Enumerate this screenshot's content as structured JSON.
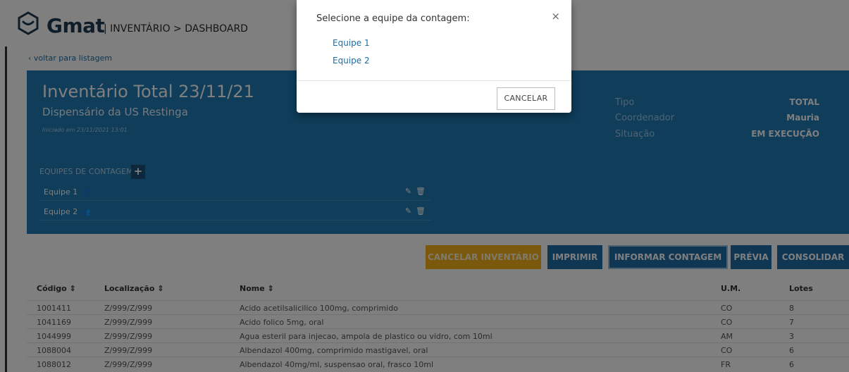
{
  "header": {
    "brand": "Gmat",
    "breadcrumb": "| INVENTÁRIO > DASHBOARD"
  },
  "back_link": "‹ voltar para listagem",
  "inventory": {
    "title": "Inventário Total 23/11/21",
    "subtitle": "Dispensário da US Restinga",
    "started": "Iniciado em 23/11/2021 13:01",
    "info": [
      {
        "label": "Tipo",
        "value": "TOTAL"
      },
      {
        "label": "Coordenador",
        "value": "Mauria"
      },
      {
        "label": "Situação",
        "value": "EM EXECUÇÃO"
      }
    ],
    "teams_header": "EQUIPES DE CONTAGEM",
    "add_icon": "+",
    "teams": [
      {
        "name": "Equipe 1",
        "icon": "👤",
        "edit": "✎",
        "delete": "🗑"
      },
      {
        "name": "Equipe 2",
        "icon": "👥",
        "edit": "✎",
        "delete": "🗑"
      }
    ]
  },
  "actions": {
    "cancel": "CANCELAR INVENTÁRIO",
    "print": "IMPRIMIR",
    "report": "INFORMAR CONTAGEM",
    "preview": "PRÉVIA",
    "consolidate": "CONSOLIDAR"
  },
  "table": {
    "columns": [
      "Código ⇕",
      "Localização ⇕",
      "Nome ⇕",
      "U.M.",
      "Lotes"
    ],
    "rows": [
      [
        "1001411",
        "Z/999/Z/999",
        "Acido acetilsalicilico 100mg, comprimido",
        "CO",
        "8"
      ],
      [
        "1041169",
        "Z/999/Z/999",
        "Acido folico 5mg, oral",
        "CO",
        "7"
      ],
      [
        "1044999",
        "Z/999/Z/999",
        "Agua esteril para injecao, ampola de plastico ou vidro, com 10ml",
        "AM",
        "3"
      ],
      [
        "1088004",
        "Z/999/Z/999",
        "Albendazol 400mg, comprimido mastigavel, oral",
        "CO",
        "6"
      ],
      [
        "1088012",
        "Z/999/Z/999",
        "Albendazol 40mg/ml, suspensao oral, frasco 10ml",
        "FR",
        "6"
      ]
    ]
  },
  "modal": {
    "title": "Selecione a equipe da contagem:",
    "close": "×",
    "options": [
      "Equipe 1",
      "Equipe 2"
    ],
    "cancel": "CANCELAR"
  },
  "colors": {
    "panel": "#1f7bb5",
    "primary_button": "#1f6fa8",
    "warning_button": "#f5b018",
    "link": "#1a6fa6"
  }
}
